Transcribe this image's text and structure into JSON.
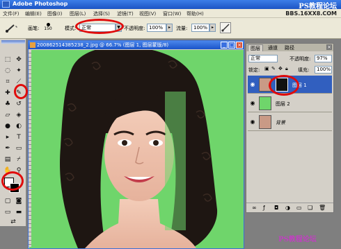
{
  "app": {
    "title": "Adobe Photoshop",
    "watermark_top": "PS教程论坛",
    "watermark_url": "BBS.16XX8.COM"
  },
  "menu": {
    "items": [
      "文件(F)",
      "编辑(E)",
      "图像(I)",
      "图层(L)",
      "选择(S)",
      "滤镜(T)",
      "视图(V)",
      "窗口(W)",
      "帮助(H)"
    ]
  },
  "options_bar": {
    "brush_label": "画笔:",
    "brush_size": "150",
    "mode_label": "模式:",
    "mode_value": "正常",
    "opacity_label": "不透明度:",
    "opacity_value": "100%",
    "flow_label": "流量:",
    "flow_value": "100%"
  },
  "document": {
    "title": "200862514385238_2.jpg @ 66.7% (图层 1, 图层蒙版/8)"
  },
  "layers_panel": {
    "tabs": [
      "图层",
      "通道",
      "路径"
    ],
    "blend_mode": "正常",
    "opacity_label": "不透明度:",
    "opacity_value": "97%",
    "lock_label": "锁定:",
    "fill_label": "填充:",
    "fill_value": "100%",
    "layers": [
      {
        "name": "图层 1",
        "active": true
      },
      {
        "name": "图层 2",
        "active": false
      },
      {
        "name": "背景",
        "active": false
      }
    ],
    "footer_icons": [
      "link-icon",
      "fx-icon",
      "mask-icon",
      "adjustment-icon",
      "folder-icon",
      "new-layer-icon",
      "trash-icon"
    ]
  },
  "colors": {
    "canvas_green": "#6fd56b",
    "highlight_red": "#e00c0c",
    "selection_blue": "#315fbf"
  },
  "watermark_bottom": "PS教程论坛"
}
